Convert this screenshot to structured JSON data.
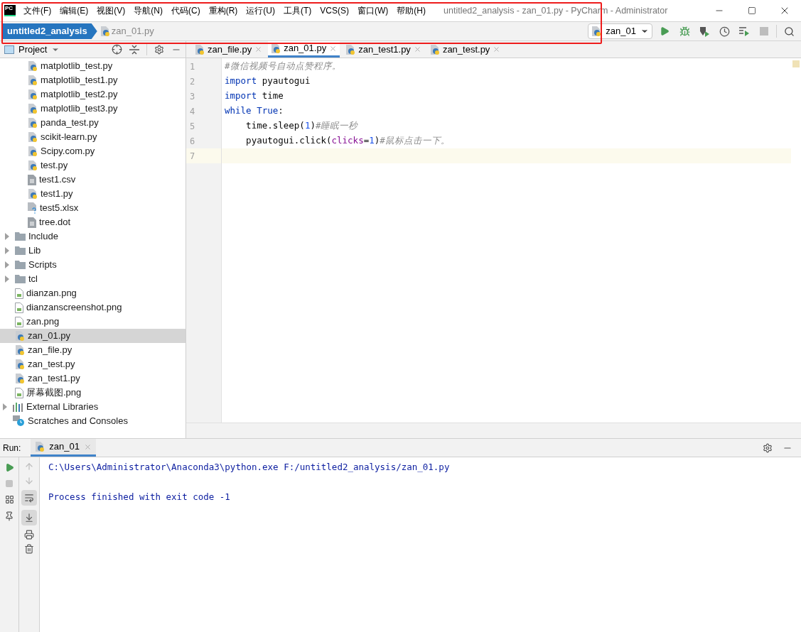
{
  "window": {
    "app_logo": "PC",
    "title": "untitled2_analysis - zan_01.py - PyCharm - Administrator"
  },
  "menu": [
    "文件(F)",
    "编辑(E)",
    "视图(V)",
    "导航(N)",
    "代码(C)",
    "重构(R)",
    "运行(U)",
    "工具(T)",
    "VCS(S)",
    "窗口(W)",
    "帮助(H)"
  ],
  "breadcrumbs": {
    "project": "untitled2_analysis",
    "file": "zan_01.py"
  },
  "run_config": "zan_01",
  "project_panel": {
    "title": "Project"
  },
  "tree": [
    {
      "children": [
        {
          "children": [
            {
              "label": "matplotlib_test.py",
              "kind": "python",
              "selected": false
            },
            {
              "label": "matplotlib_test1.py",
              "kind": "python",
              "selected": false
            },
            {
              "label": "matplotlib_test2.py",
              "kind": "python",
              "selected": false
            },
            {
              "label": "matplotlib_test3.py",
              "kind": "python",
              "selected": false
            },
            {
              "label": "panda_test.py",
              "kind": "python",
              "selected": false
            },
            {
              "label": "scikit-learn.py",
              "kind": "python",
              "selected": false
            },
            {
              "label": "Scipy.com.py",
              "kind": "python",
              "selected": false
            },
            {
              "label": "test.py",
              "kind": "python",
              "selected": false
            },
            {
              "label": "test1.csv",
              "kind": "text",
              "selected": false
            },
            {
              "label": "test1.py",
              "kind": "python",
              "selected": false
            },
            {
              "label": "test5.xlsx",
              "kind": "unknown",
              "selected": false
            },
            {
              "label": "tree.dot",
              "kind": "text",
              "selected": false
            }
          ]
        },
        {
          "label": "Include",
          "kind": "folder",
          "expanded": false,
          "selected": false
        },
        {
          "label": "Lib",
          "kind": "folder",
          "expanded": false,
          "selected": false
        },
        {
          "label": "Scripts",
          "kind": "folder",
          "expanded": false,
          "selected": false
        },
        {
          "label": "tcl",
          "kind": "folder",
          "expanded": false,
          "selected": false
        },
        {
          "label": "dianzan.png",
          "kind": "image",
          "selected": false
        },
        {
          "label": "dianzanscreenshot.png",
          "kind": "image",
          "selected": false
        },
        {
          "label": "zan.png",
          "kind": "image",
          "selected": false
        },
        {
          "label": "zan_01.py",
          "kind": "python",
          "selected": true
        },
        {
          "label": "zan_file.py",
          "kind": "python",
          "selected": false
        },
        {
          "label": "zan_test.py",
          "kind": "python",
          "selected": false
        },
        {
          "label": "zan_test1.py",
          "kind": "python",
          "selected": false
        },
        {
          "label": "屏幕截图.png",
          "kind": "image",
          "selected": false
        }
      ]
    },
    {
      "label": "External Libraries",
      "kind": "libraries",
      "expanded": false,
      "selected": false
    },
    {
      "label": "Scratches and Consoles",
      "kind": "scratches",
      "selected": false
    }
  ],
  "editor_tabs": [
    {
      "label": "zan_file.py",
      "selected": false
    },
    {
      "label": "zan_01.py",
      "selected": true
    },
    {
      "label": "zan_test1.py",
      "selected": false
    },
    {
      "label": "zan_test.py",
      "selected": false
    }
  ],
  "code": [
    {
      "number": "1",
      "tokens": [
        {
          "kind": "comment",
          "text": "#微信视频号自动点赞程序。"
        }
      ]
    },
    {
      "number": "2",
      "tokens": [
        {
          "kind": "keyword",
          "text": "import"
        },
        {
          "kind": "plain",
          "text": " pyautogui"
        }
      ]
    },
    {
      "number": "3",
      "tokens": [
        {
          "kind": "keyword",
          "text": "import"
        },
        {
          "kind": "plain",
          "text": " time"
        }
      ]
    },
    {
      "number": "4",
      "tokens": [
        {
          "kind": "keyword",
          "text": "while"
        },
        {
          "kind": "constant",
          "text": " True"
        },
        {
          "kind": "plain",
          "text": ":"
        }
      ]
    },
    {
      "number": "5",
      "tokens": [
        {
          "kind": "plain",
          "text": "    time.sleep("
        },
        {
          "kind": "number",
          "text": "1"
        },
        {
          "kind": "plain",
          "text": ")"
        },
        {
          "kind": "comment",
          "text": "#睡眠一秒"
        }
      ]
    },
    {
      "number": "6",
      "tokens": [
        {
          "kind": "plain",
          "text": "    pyautogui.click("
        },
        {
          "kind": "param",
          "text": "clicks"
        },
        {
          "kind": "plain",
          "text": "="
        },
        {
          "kind": "number",
          "text": "1"
        },
        {
          "kind": "plain",
          "text": ")"
        },
        {
          "kind": "comment",
          "text": "#鼠标点击一下。"
        }
      ]
    },
    {
      "number": "7",
      "current": true
    }
  ],
  "run_panel": {
    "label": "Run:",
    "tab": "zan_01",
    "output": [
      "C:\\Users\\Administrator\\Anaconda3\\python.exe F:/untitled2_analysis/zan_01.py",
      "Process finished with exit code -1"
    ]
  }
}
